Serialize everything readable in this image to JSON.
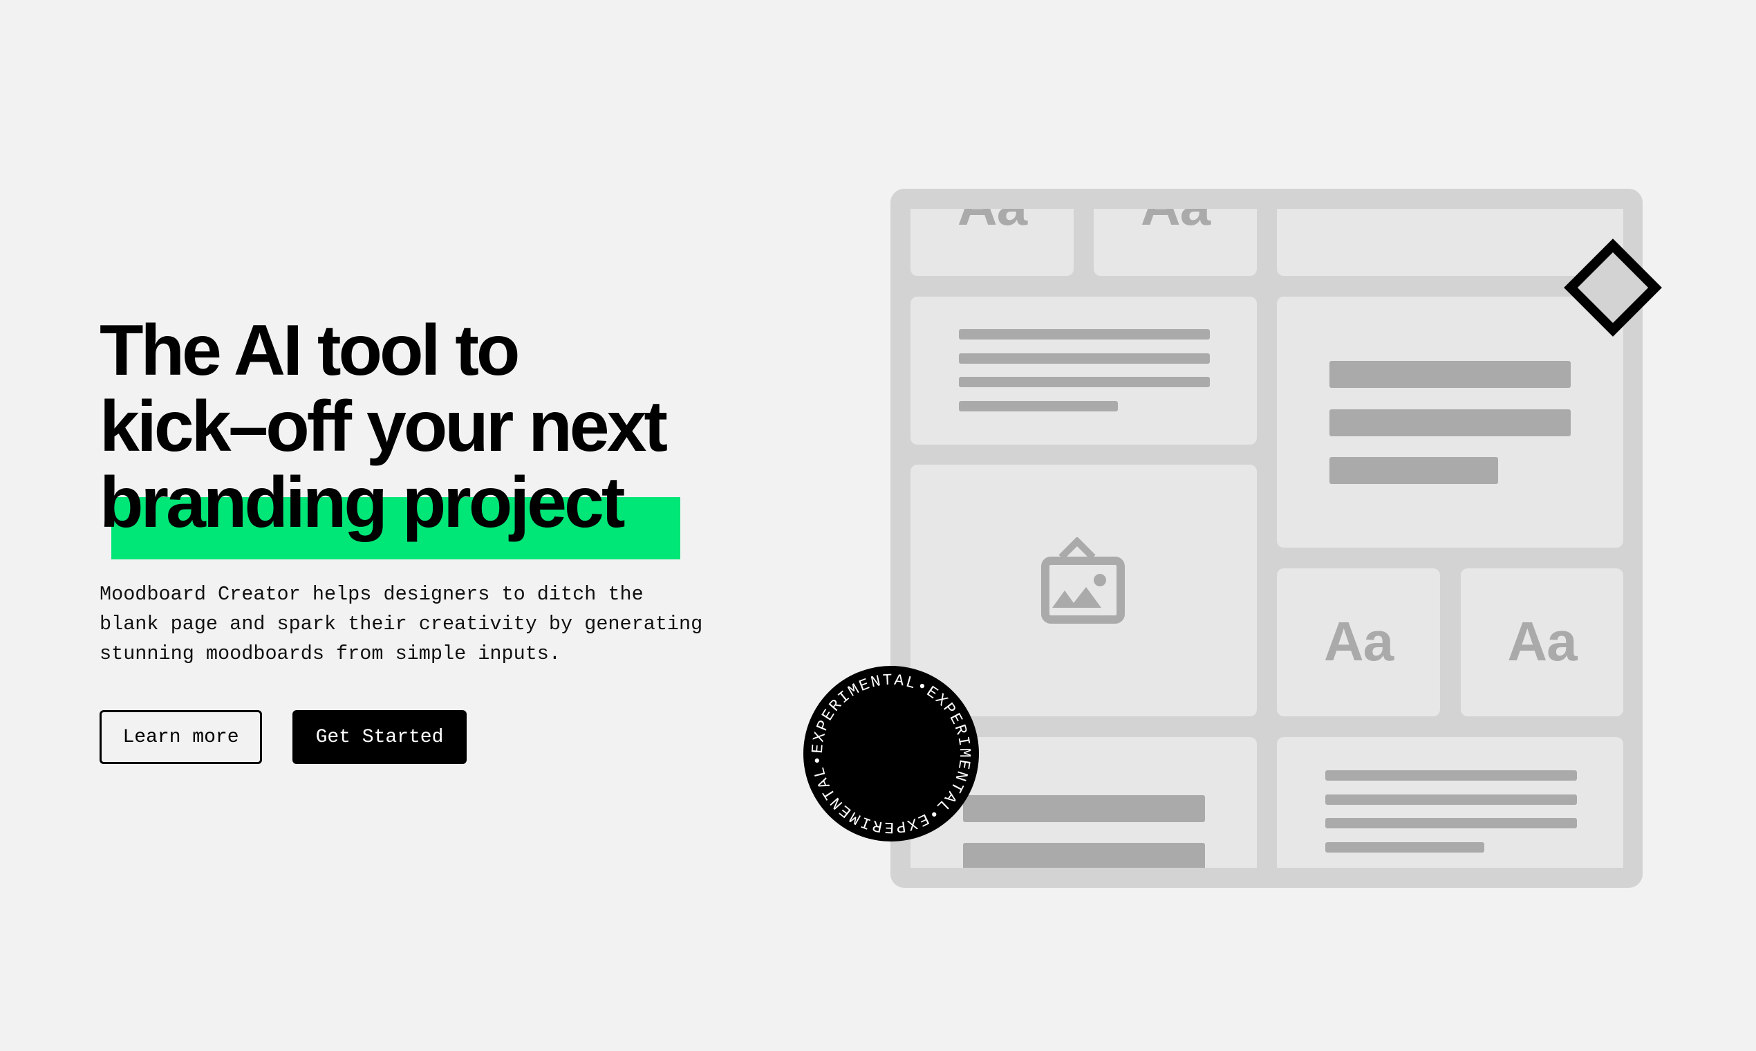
{
  "hero": {
    "headline": {
      "lines": [
        "The AI tool to",
        "kick–off your next",
        "branding project"
      ],
      "highlight_color": "#00e677"
    },
    "description": {
      "lines": [
        "Moodboard Creator helps designers to ditch the",
        "blank page and spark their creativity by generating",
        "stunning moodboards from simple inputs."
      ]
    },
    "buttons": {
      "learn_more": "Learn more",
      "get_started": "Get Started"
    }
  },
  "illustration": {
    "type_specimen_label": "Aa",
    "image_icon": "image-placeholder-icon",
    "decorations": {
      "diamond_icon": "diamond-icon",
      "badge_text": "EXPERIMENTAL•EXPERIMENTAL•EXPERIMENTAL•"
    }
  },
  "colors": {
    "background": "#f2f2f2",
    "frame": "#d3d3d3",
    "card": "#e7e7e7",
    "placeholder": "#aaaaaa",
    "accent": "#00e677",
    "ink": "#000000"
  }
}
